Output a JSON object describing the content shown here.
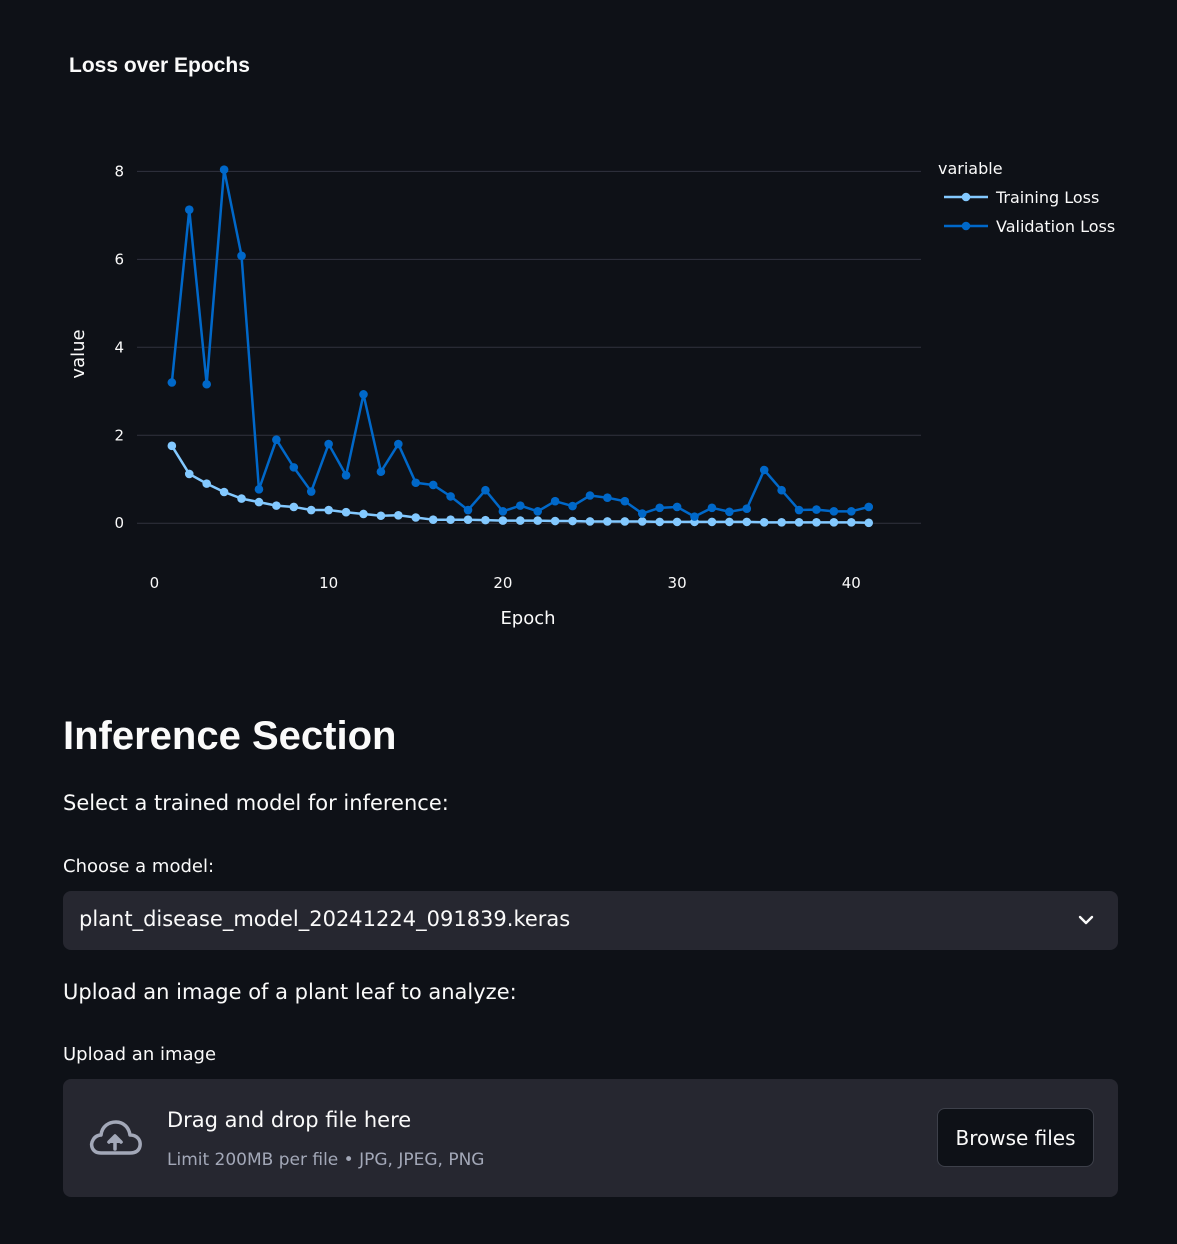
{
  "chart": {
    "title": "Loss over Epochs",
    "legend_title": "variable"
  },
  "chart_data": {
    "type": "line",
    "xlabel": "Epoch",
    "ylabel": "value",
    "xlim": [
      -1,
      44
    ],
    "ylim": [
      -0.7,
      8.35
    ],
    "xticks": [
      0,
      10,
      20,
      30,
      40
    ],
    "yticks": [
      0,
      2,
      4,
      6,
      8
    ],
    "legend_position": "top-right",
    "x": [
      1,
      2,
      3,
      4,
      5,
      6,
      7,
      8,
      9,
      10,
      11,
      12,
      13,
      14,
      15,
      16,
      17,
      18,
      19,
      20,
      21,
      22,
      23,
      24,
      25,
      26,
      27,
      28,
      29,
      30,
      31,
      32,
      33,
      34,
      35,
      36,
      37,
      38,
      39,
      40,
      41
    ],
    "series": [
      {
        "name": "Training Loss",
        "color": "#83c9ff",
        "values": [
          1.76,
          1.12,
          0.9,
          0.71,
          0.56,
          0.48,
          0.4,
          0.37,
          0.3,
          0.3,
          0.25,
          0.21,
          0.17,
          0.18,
          0.13,
          0.08,
          0.08,
          0.08,
          0.07,
          0.06,
          0.06,
          0.06,
          0.05,
          0.05,
          0.04,
          0.04,
          0.04,
          0.04,
          0.03,
          0.03,
          0.03,
          0.03,
          0.03,
          0.03,
          0.02,
          0.02,
          0.02,
          0.02,
          0.02,
          0.02,
          0.01
        ]
      },
      {
        "name": "Validation Loss",
        "color": "#0068c9",
        "values": [
          3.2,
          7.13,
          3.16,
          8.04,
          6.08,
          0.77,
          1.9,
          1.27,
          0.72,
          1.8,
          1.09,
          2.93,
          1.17,
          1.8,
          0.92,
          0.87,
          0.61,
          0.3,
          0.75,
          0.27,
          0.4,
          0.27,
          0.5,
          0.39,
          0.63,
          0.58,
          0.5,
          0.22,
          0.35,
          0.37,
          0.15,
          0.35,
          0.26,
          0.33,
          1.21,
          0.75,
          0.3,
          0.31,
          0.27,
          0.27,
          0.37
        ]
      }
    ]
  },
  "inference": {
    "title": "Inference Section",
    "select_prompt": "Select a trained model for inference:",
    "model_label": "Choose a model:",
    "selected_model": "plant_disease_model_20241224_091839.keras",
    "upload_prompt": "Upload an image of a plant leaf to analyze:",
    "upload_label": "Upload an image",
    "drop_text": "Drag and drop file here",
    "limit_text": "Limit 200MB per file • JPG, JPEG, PNG",
    "browse_label": "Browse files",
    "icons": {
      "select": "chevron-down-icon",
      "upload": "cloud-upload-icon"
    }
  }
}
